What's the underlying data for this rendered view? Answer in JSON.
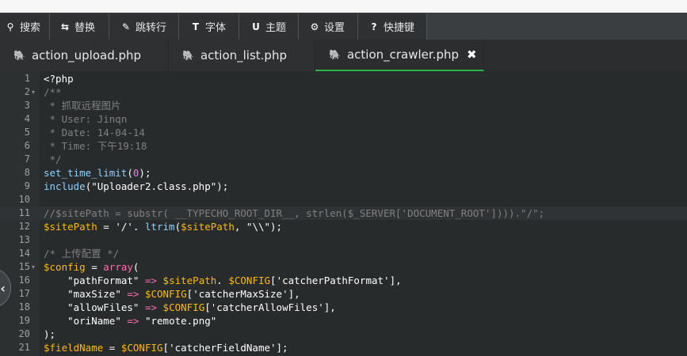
{
  "toolbar": {
    "items": [
      {
        "icon": "search-icon",
        "glyph": "⚲",
        "label": "搜索"
      },
      {
        "icon": "replace-icon",
        "glyph": "⇆",
        "label": "替换"
      },
      {
        "icon": "goto-line-icon",
        "glyph": "✎",
        "label": "跳转行"
      },
      {
        "icon": "font-icon",
        "glyph": "T",
        "label": "字体"
      },
      {
        "icon": "theme-icon",
        "glyph": "U",
        "label": "主题"
      },
      {
        "icon": "gear-icon",
        "glyph": "⚙",
        "label": "设置"
      },
      {
        "icon": "help-icon",
        "glyph": "?",
        "label": "快捷键"
      }
    ]
  },
  "tabs": [
    {
      "label": "action_upload.php",
      "active": false
    },
    {
      "label": "action_list.php",
      "active": false
    },
    {
      "label": "action_crawler.php",
      "active": true,
      "close": "✖"
    }
  ],
  "editor": {
    "lines": [
      {
        "n": "1",
        "fold": "",
        "tokens": [
          [
            "kw",
            "<?php"
          ]
        ]
      },
      {
        "n": "2",
        "fold": "▾",
        "tokens": [
          [
            "cm",
            "/**"
          ]
        ]
      },
      {
        "n": "3",
        "fold": "",
        "tokens": [
          [
            "cm",
            " * 抓取远程图片"
          ]
        ]
      },
      {
        "n": "4",
        "fold": "",
        "tokens": [
          [
            "cm",
            " * User: Jinqn"
          ]
        ]
      },
      {
        "n": "5",
        "fold": "",
        "tokens": [
          [
            "cm",
            " * Date: 14-04-14"
          ]
        ]
      },
      {
        "n": "6",
        "fold": "",
        "tokens": [
          [
            "cm",
            " * Time: 下午19:18"
          ]
        ]
      },
      {
        "n": "7",
        "fold": "",
        "tokens": [
          [
            "cm",
            " */"
          ]
        ]
      },
      {
        "n": "8",
        "fold": "",
        "tokens": [
          [
            "fn",
            "set_time_limit"
          ],
          [
            "kw",
            "("
          ],
          [
            "num",
            "0"
          ],
          [
            "kw",
            ");"
          ]
        ]
      },
      {
        "n": "9",
        "fold": "",
        "tokens": [
          [
            "fn",
            "include"
          ],
          [
            "kw",
            "("
          ],
          [
            "str",
            "\"Uploader2.class.php\""
          ],
          [
            "kw",
            ");"
          ]
        ]
      },
      {
        "n": "10",
        "fold": "",
        "tokens": []
      },
      {
        "n": "11",
        "fold": "",
        "hl": true,
        "tokens": [
          [
            "cm",
            "//$sitePath = substr( __TYPECHO_ROOT_DIR__, strlen($_SERVER['DOCUMENT_ROOT']))).\"/\";"
          ]
        ]
      },
      {
        "n": "12",
        "fold": "",
        "tokens": [
          [
            "var",
            "$sitePath"
          ],
          [
            "kw",
            " = "
          ],
          [
            "sq",
            "'/'"
          ],
          [
            "kw",
            ". "
          ],
          [
            "fn",
            "ltrim"
          ],
          [
            "kw",
            "("
          ],
          [
            "var",
            "$sitePath"
          ],
          [
            "kw",
            ", "
          ],
          [
            "str",
            "\"\\\\\""
          ],
          [
            "kw",
            ");"
          ]
        ]
      },
      {
        "n": "13",
        "fold": "",
        "tokens": []
      },
      {
        "n": "14",
        "fold": "",
        "tokens": [
          [
            "cm",
            "/* 上传配置 */"
          ]
        ]
      },
      {
        "n": "15",
        "fold": "▾",
        "tokens": [
          [
            "var",
            "$config"
          ],
          [
            "kw",
            " = "
          ],
          [
            "op",
            "array"
          ],
          [
            "kw",
            "("
          ]
        ]
      },
      {
        "n": "16",
        "fold": "",
        "tokens": [
          [
            "kw",
            "    "
          ],
          [
            "str",
            "\"pathFormat\""
          ],
          [
            "kw",
            " "
          ],
          [
            "op",
            "=>"
          ],
          [
            "kw",
            " "
          ],
          [
            "var",
            "$sitePath"
          ],
          [
            "kw",
            ". "
          ],
          [
            "var",
            "$CONFIG"
          ],
          [
            "kw",
            "["
          ],
          [
            "sq",
            "'catcherPathFormat'"
          ],
          [
            "kw",
            "],"
          ]
        ]
      },
      {
        "n": "17",
        "fold": "",
        "tokens": [
          [
            "kw",
            "    "
          ],
          [
            "str",
            "\"maxSize\""
          ],
          [
            "kw",
            " "
          ],
          [
            "op",
            "=>"
          ],
          [
            "kw",
            " "
          ],
          [
            "var",
            "$CONFIG"
          ],
          [
            "kw",
            "["
          ],
          [
            "sq",
            "'catcherMaxSize'"
          ],
          [
            "kw",
            "],"
          ]
        ]
      },
      {
        "n": "18",
        "fold": "",
        "tokens": [
          [
            "kw",
            "    "
          ],
          [
            "str",
            "\"allowFiles\""
          ],
          [
            "kw",
            " "
          ],
          [
            "op",
            "=>"
          ],
          [
            "kw",
            " "
          ],
          [
            "var",
            "$CONFIG"
          ],
          [
            "kw",
            "["
          ],
          [
            "sq",
            "'catcherAllowFiles'"
          ],
          [
            "kw",
            "],"
          ]
        ]
      },
      {
        "n": "19",
        "fold": "",
        "tokens": [
          [
            "kw",
            "    "
          ],
          [
            "str",
            "\"oriName\""
          ],
          [
            "kw",
            " "
          ],
          [
            "op",
            "=>"
          ],
          [
            "kw",
            " "
          ],
          [
            "str",
            "\"remote.png\""
          ]
        ]
      },
      {
        "n": "20",
        "fold": "",
        "tokens": [
          [
            "kw",
            ");"
          ]
        ]
      },
      {
        "n": "21",
        "fold": "",
        "tokens": [
          [
            "var",
            "$fieldName"
          ],
          [
            "kw",
            " = "
          ],
          [
            "var",
            "$CONFIG"
          ],
          [
            "kw",
            "["
          ],
          [
            "sq",
            "'catcherFieldName'"
          ],
          [
            "kw",
            "];"
          ]
        ]
      }
    ]
  },
  "side_handle": {
    "glyph": "‹",
    "icon": "chevron-left-icon"
  }
}
